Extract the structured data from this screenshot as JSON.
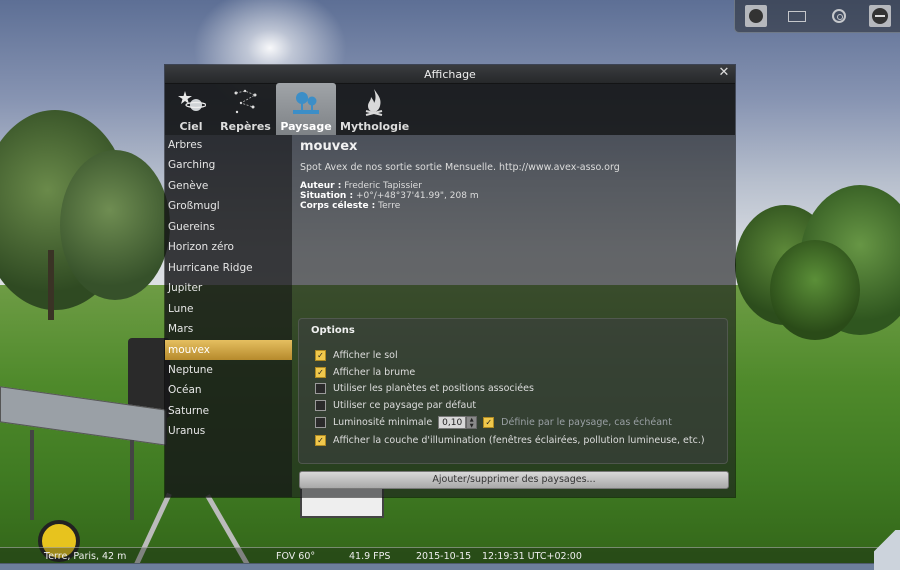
{
  "toolbar": {
    "icons": [
      "constellation-art-icon",
      "ground-icon",
      "atmosphere-icon",
      "telescope-icon"
    ]
  },
  "dialog": {
    "title": "Affichage",
    "close_label": "✕",
    "tabs": [
      {
        "label": "Ciel",
        "icon": "stars-planets-icon"
      },
      {
        "label": "Repères",
        "icon": "markings-icon"
      },
      {
        "label": "Paysage",
        "icon": "landscape-trees-icon",
        "active": true
      },
      {
        "label": "Mythologie",
        "icon": "fire-icon"
      }
    ],
    "landscapes": [
      "Arbres",
      "Garching",
      "Genève",
      "Großmugl",
      "Guereins",
      "Horizon zéro",
      "Hurricane Ridge",
      "Jupiter",
      "Lune",
      "Mars",
      "mouvex",
      "Neptune",
      "Océan",
      "Saturne",
      "Uranus"
    ],
    "selected_landscape": "mouvex",
    "info": {
      "name": "mouvex",
      "description": "Spot Avex de nos sortie sortie Mensuelle. http://www.avex-asso.org",
      "author_label": "Auteur :",
      "author": "Frederic Tapissier",
      "location_label": "Situation :",
      "location": "+0°/+48°37'41.99\", 208 m",
      "body_label": "Corps céleste :",
      "body": "Terre"
    },
    "options": {
      "title": "Options",
      "show_ground": "Afficher le sol",
      "show_fog": "Afficher la brume",
      "use_associated_planet": "Utiliser les planètes et positions associées",
      "use_as_default": "Utiliser ce paysage par défaut",
      "min_brightness": "Luminosité minimale",
      "min_brightness_value": "0,10",
      "defined_by_landscape": "Définie par le paysage, cas échéant",
      "show_illumination": "Afficher la couche d'illumination (fenêtres éclairées, pollution lumineuse, etc.)"
    },
    "add_remove_button": "Ajouter/supprimer des paysages..."
  },
  "statusbar": {
    "location": "Terre, Paris, 42 m",
    "fov": "FOV 60°",
    "fps": "41.9 FPS",
    "date": "2015-10-15",
    "time": "12:19:31 UTC+02:00"
  },
  "colors": {
    "selection_gold": "#d4a84a",
    "checkbox_on": "#f0c84c"
  }
}
